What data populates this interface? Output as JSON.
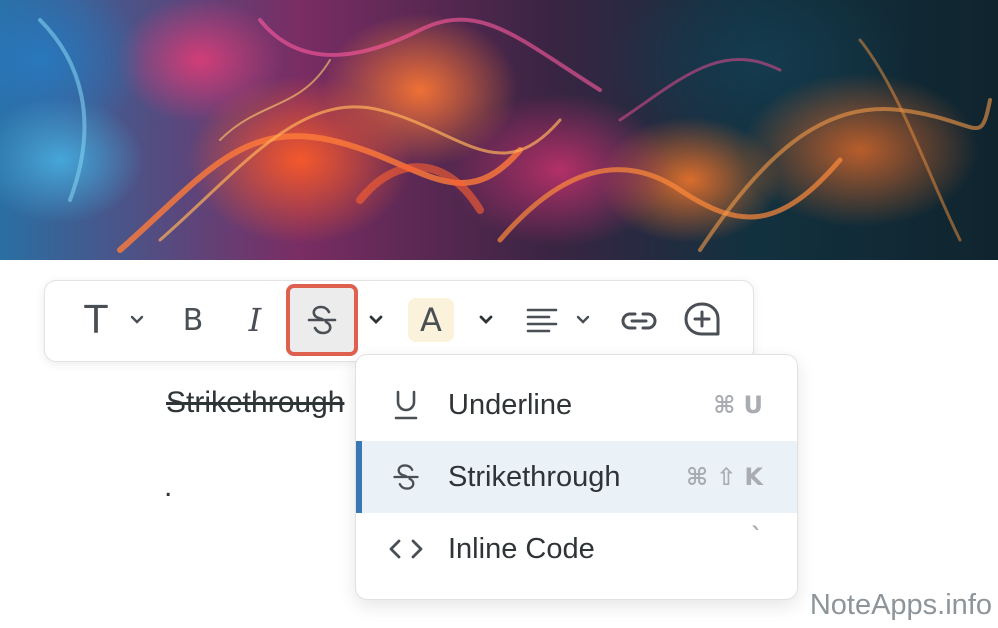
{
  "toolbar": {
    "text_style_glyph": "T",
    "bold_glyph": "B",
    "italic_glyph": "I",
    "text_color_glyph": "A"
  },
  "document": {
    "strikethrough_text": "Strikethrough",
    "dot_text": "."
  },
  "menu": {
    "items": [
      {
        "label": "Underline",
        "shortcut": "⌘U",
        "icon": "underline-icon",
        "selected": false
      },
      {
        "label": "Strikethrough",
        "shortcut": "⌘⇧K",
        "icon": "strikethrough-icon",
        "selected": true
      },
      {
        "label": "Inline Code",
        "shortcut": "`",
        "icon": "code-icon",
        "selected": false
      }
    ]
  },
  "watermark": "NoteApps.info",
  "colors": {
    "highlight_border": "#e0604f",
    "selected_bar": "#3a78b5",
    "selected_bg": "#eaf1f7",
    "text_color_highlight": "#fbf2dc"
  }
}
